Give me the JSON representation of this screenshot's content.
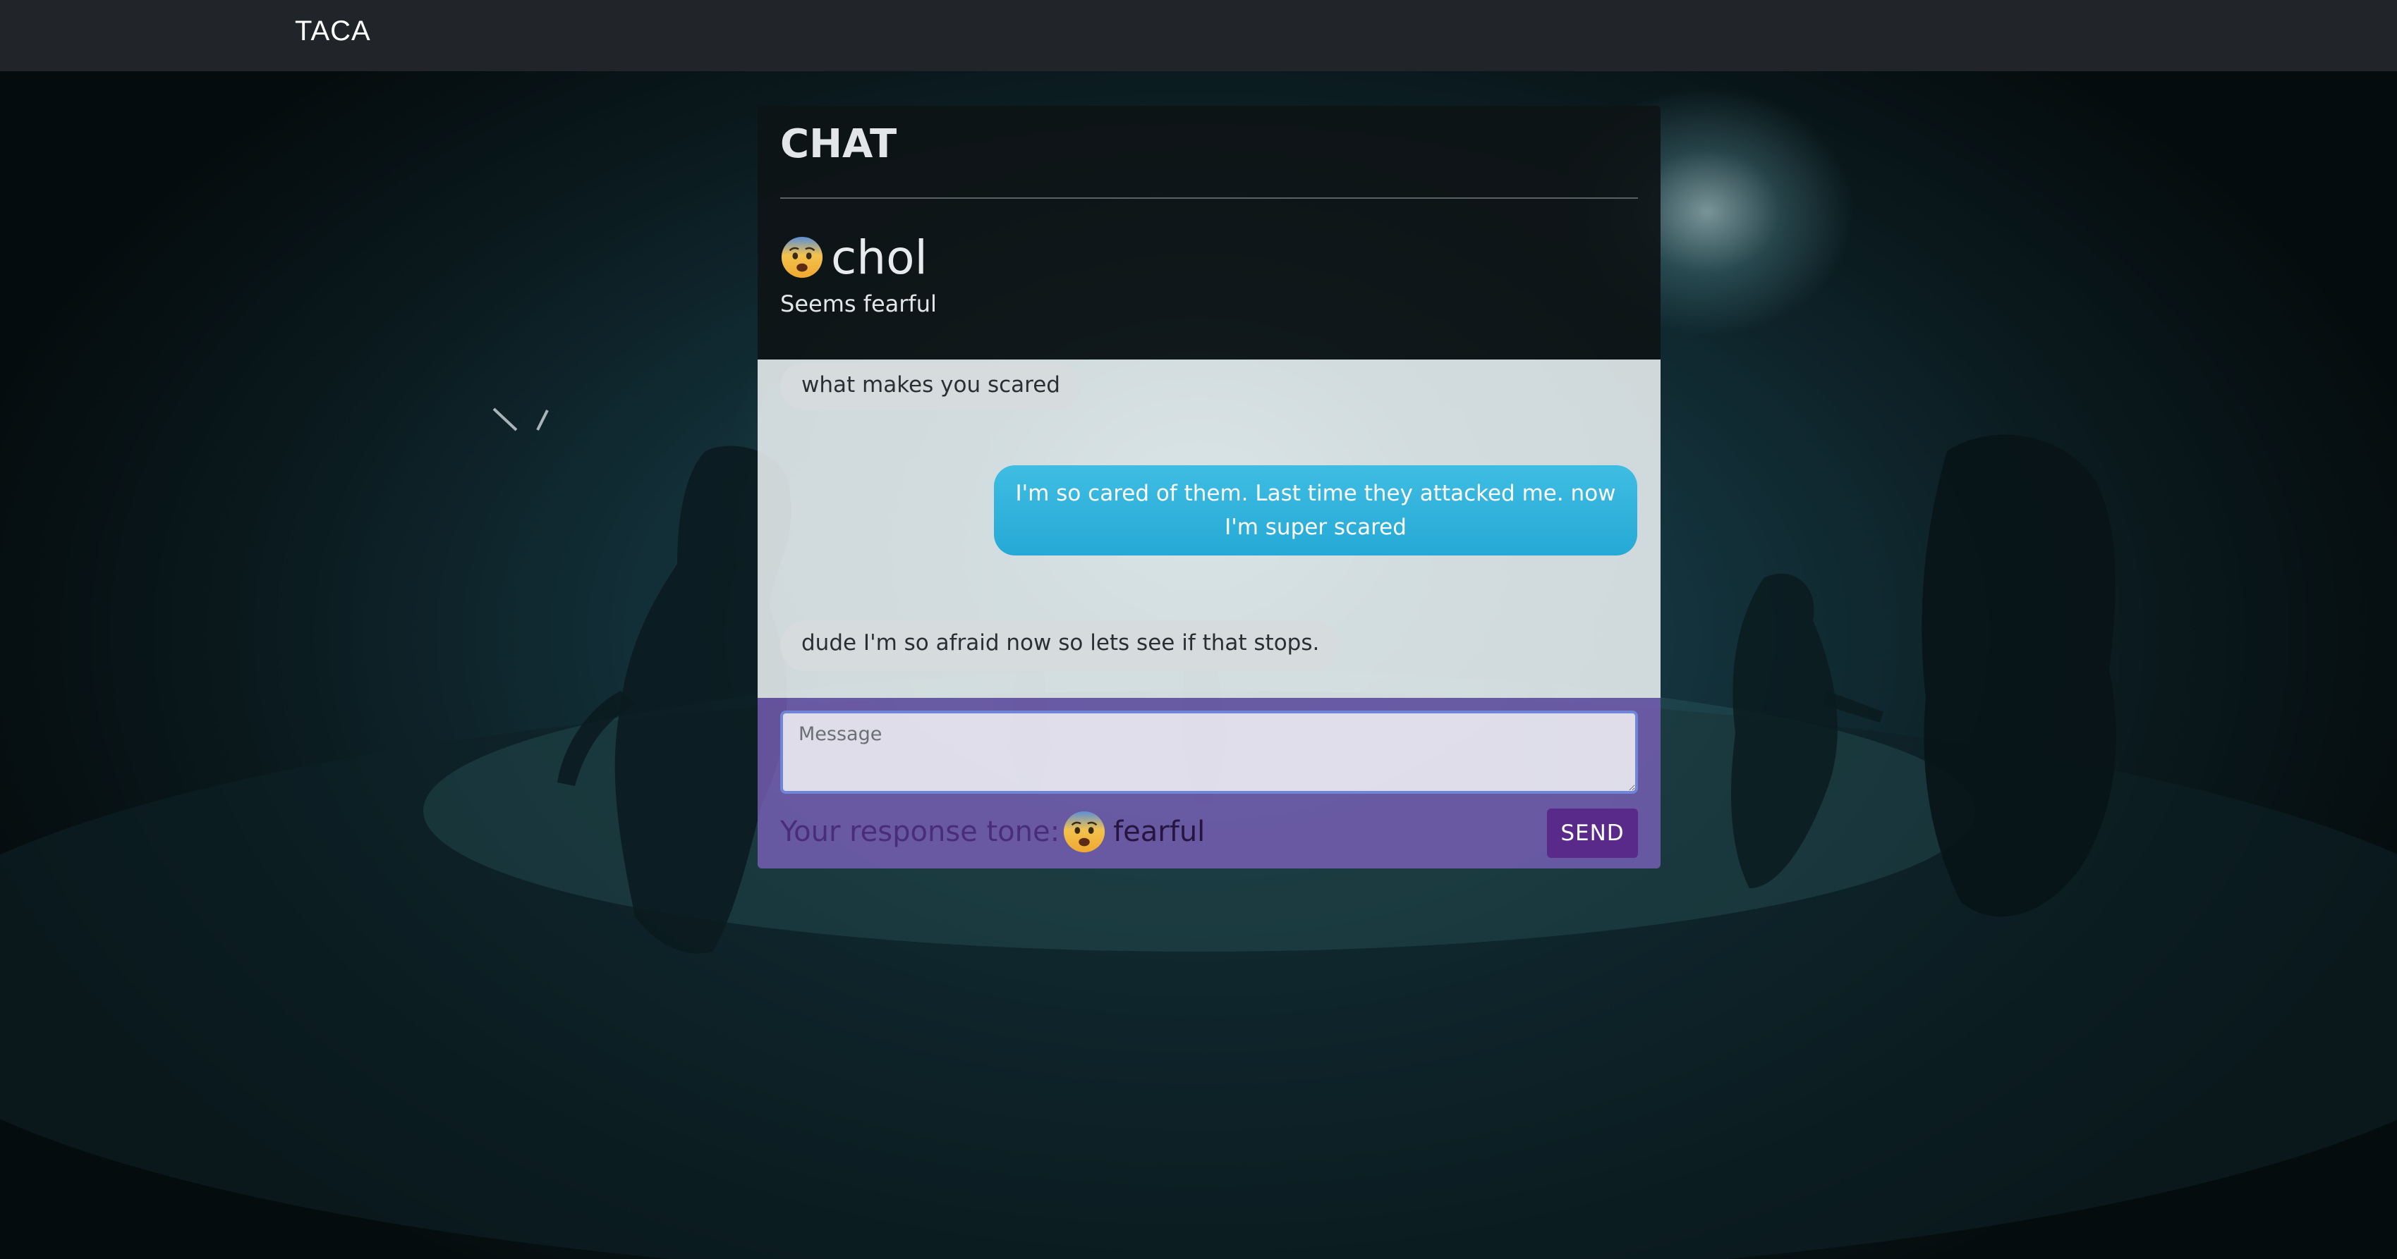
{
  "navbar": {
    "brand": "TACA"
  },
  "chat": {
    "title": "CHAT",
    "contact": {
      "emoji_icon": "fearful-face-icon",
      "name": "chol",
      "status": "Seems fearful"
    },
    "messages": [
      {
        "direction": "incoming",
        "text": "what makes you scared"
      },
      {
        "direction": "outgoing",
        "text": "I'm so cared of them. Last time they attacked me. now I'm super scared"
      },
      {
        "direction": "incoming",
        "text": "dude I'm so afraid now so lets see if that stops."
      }
    ],
    "composer": {
      "input_value": "",
      "placeholder": "Message",
      "tone_label": "Your response tone:",
      "tone_emoji_icon": "fearful-face-icon",
      "tone_value": "fearful",
      "send_label": "SEND"
    }
  },
  "colors": {
    "navbar": "#212529",
    "outgoing_bubble": "#2eb1d9",
    "incoming_bubble": "#d6dbdd",
    "composer_background": "#7d62be",
    "send_button": "#5a2a8a",
    "input_focus_border": "#6f86d6"
  }
}
